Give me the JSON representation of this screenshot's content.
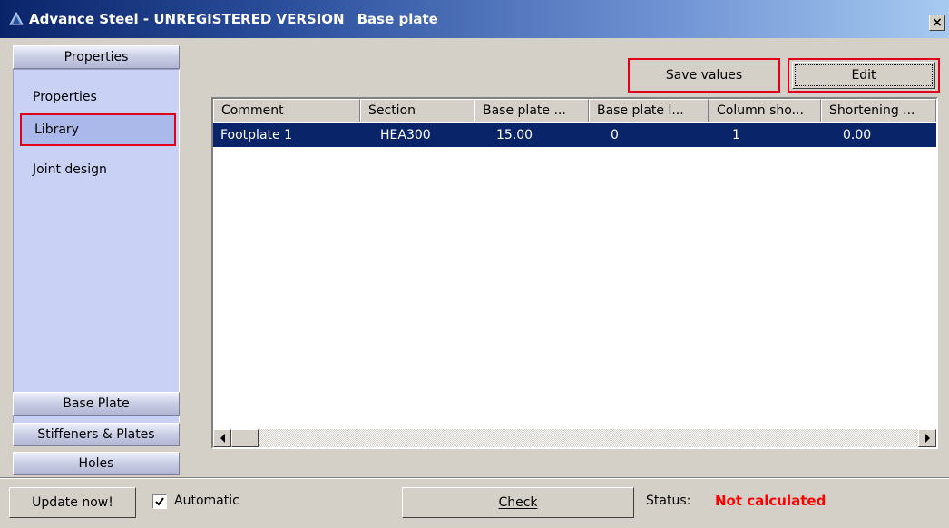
{
  "window": {
    "title": "Advance Steel - UNREGISTERED VERSION",
    "subtitle": "Base plate",
    "close_glyph": "×"
  },
  "sidebar": {
    "top_header": "Properties",
    "items": [
      {
        "label": "Properties",
        "selected": false
      },
      {
        "label": "Library",
        "selected": true
      },
      {
        "label": "Joint design",
        "selected": false
      }
    ],
    "bottom_headers": [
      "Base Plate",
      "Stiffeners & Plates",
      "Holes"
    ]
  },
  "toolbar": {
    "save_label": "Save values",
    "edit_label": "Edit"
  },
  "table": {
    "columns": [
      "Comment",
      "Section",
      "Base plate ...",
      "Base plate l...",
      "Column sho...",
      "Shortening ..."
    ],
    "rows": [
      [
        "Footplate 1",
        "HEA300",
        "15.00",
        "0",
        "1",
        "0.00"
      ]
    ]
  },
  "bottom": {
    "update_label": "Update now!",
    "automatic_label": "Automatic",
    "automatic_checked": true,
    "check_label": "Check",
    "status_label": "Status:",
    "status_value": "Not calculated"
  },
  "colors": {
    "highlight": "#e3001b",
    "selection": "#0a246a",
    "status_error": "#ff0000"
  },
  "icons": [
    "app-icon",
    "close-icon",
    "checkmark-icon",
    "scroll-left-icon",
    "scroll-right-icon"
  ]
}
